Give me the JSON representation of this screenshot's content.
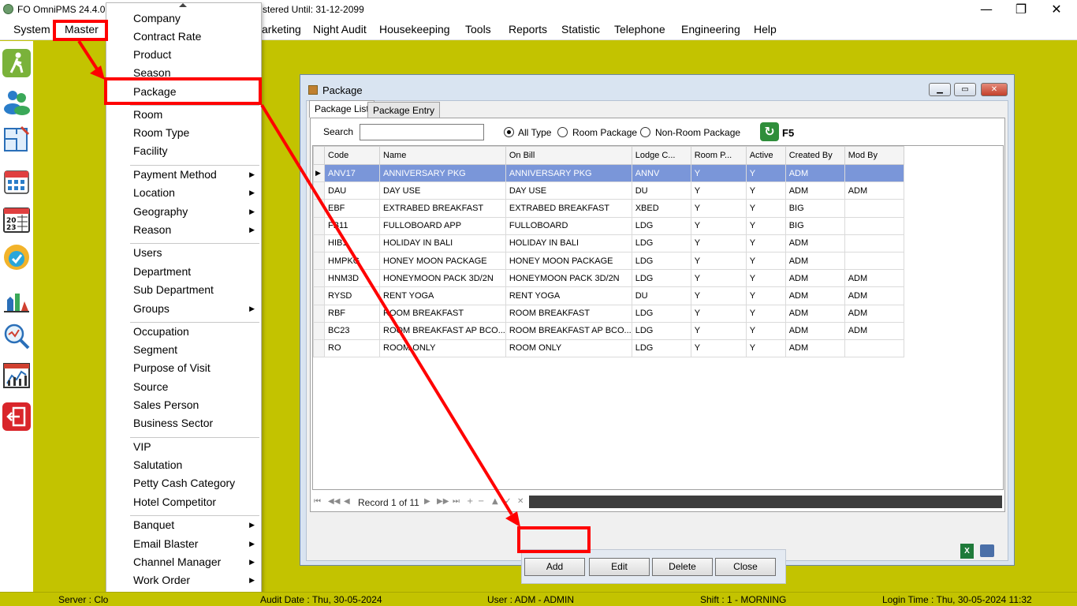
{
  "titlebar": {
    "title": "FO OmniPMS 24.4.0.",
    "title_tail": "stered Until: 31-12-2099",
    "minimize": "—",
    "maximize": "❐",
    "close": "✕"
  },
  "menubar": {
    "items": [
      "System",
      "Master",
      "arketing",
      "Night Audit",
      "Housekeeping",
      "Tools",
      "Reports",
      "Statistic",
      "Telephone",
      "Engineering",
      "Help"
    ]
  },
  "left_toolbar": {
    "icons": [
      "walk-in-icon",
      "guests-icon",
      "floor-plan-icon",
      "calendar-icon",
      "calendar-2023-icon",
      "check-badge-icon",
      "housekeeping-icon",
      "search-chart-icon",
      "statistics-icon",
      "exit-icon"
    ]
  },
  "dropdown": {
    "items": [
      {
        "label": "Company",
        "sub": false
      },
      {
        "label": "Contract Rate",
        "sub": false
      },
      {
        "label": "Product",
        "sub": false
      },
      {
        "label": "Season",
        "sub": false
      },
      {
        "label": "Package",
        "sub": false
      },
      {
        "label": "Room",
        "sub": false
      },
      {
        "label": "Room Type",
        "sub": false
      },
      {
        "label": "Facility",
        "sub": false
      },
      {
        "label": "Payment Method",
        "sub": true
      },
      {
        "label": "Location",
        "sub": true
      },
      {
        "label": "Geography",
        "sub": true
      },
      {
        "label": "Reason",
        "sub": true
      },
      {
        "label": "Users",
        "sub": false
      },
      {
        "label": "Department",
        "sub": false
      },
      {
        "label": "Sub Department",
        "sub": false
      },
      {
        "label": "Groups",
        "sub": true
      },
      {
        "label": "Occupation",
        "sub": false
      },
      {
        "label": "Segment",
        "sub": false
      },
      {
        "label": "Purpose of Visit",
        "sub": false
      },
      {
        "label": "Source",
        "sub": false
      },
      {
        "label": "Sales Person",
        "sub": false
      },
      {
        "label": "Business Sector",
        "sub": false
      },
      {
        "label": "VIP",
        "sub": false
      },
      {
        "label": "Salutation",
        "sub": false
      },
      {
        "label": "Petty Cash Category",
        "sub": false
      },
      {
        "label": "Hotel Competitor",
        "sub": false
      },
      {
        "label": "Banquet",
        "sub": true
      },
      {
        "label": "Email Blaster",
        "sub": true
      },
      {
        "label": "Channel Manager",
        "sub": true
      },
      {
        "label": "Work Order",
        "sub": true
      }
    ],
    "submenu_arrow": "▶"
  },
  "package_window": {
    "title": "Package",
    "tabs": [
      "Package List",
      "Package Entry"
    ],
    "search_label": "Search",
    "search_value": "",
    "filter_options": [
      "All Type",
      "Room Package",
      "Non-Room Package"
    ],
    "filter_selected": "All Type",
    "refresh_label": "F5",
    "columns": [
      "Code",
      "Name",
      "On Bill",
      "Lodge C...",
      "Room P...",
      "Active",
      "Created By",
      "Mod By"
    ],
    "rows": [
      [
        "ANV17",
        "ANNIVERSARY PKG",
        "ANNIVERSARY PKG",
        "ANNV",
        "Y",
        "Y",
        "ADM",
        ""
      ],
      [
        "DAU",
        "DAY USE",
        "DAY USE",
        "DU",
        "Y",
        "Y",
        "ADM",
        "ADM"
      ],
      [
        "EBF",
        "EXTRABED BREAKFAST",
        "EXTRABED BREAKFAST",
        "XBED",
        "Y",
        "Y",
        "BIG",
        ""
      ],
      [
        "FB11",
        "FULLOBOARD APP",
        "FULLOBOARD",
        "LDG",
        "Y",
        "Y",
        "BIG",
        ""
      ],
      [
        "HIB1",
        "HOLIDAY IN BALI",
        "HOLIDAY IN BALI",
        "LDG",
        "Y",
        "Y",
        "ADM",
        ""
      ],
      [
        "HMPKG",
        "HONEY MOON PACKAGE",
        "HONEY MOON PACKAGE",
        "LDG",
        "Y",
        "Y",
        "ADM",
        ""
      ],
      [
        "HNM3D",
        "HONEYMOON PACK 3D/2N",
        "HONEYMOON PACK 3D/2N",
        "LDG",
        "Y",
        "Y",
        "ADM",
        "ADM"
      ],
      [
        "RYSD",
        "RENT YOGA",
        "RENT YOGA",
        "DU",
        "Y",
        "Y",
        "ADM",
        "ADM"
      ],
      [
        "RBF",
        "ROOM BREAKFAST",
        "ROOM BREAKFAST",
        "LDG",
        "Y",
        "Y",
        "ADM",
        "ADM"
      ],
      [
        "BC23",
        "ROOM BREAKFAST AP BCO...",
        "ROOM BREAKFAST AP BCO...",
        "LDG",
        "Y",
        "Y",
        "ADM",
        "ADM"
      ],
      [
        "RO",
        "ROOM ONLY",
        "ROOM ONLY",
        "LDG",
        "Y",
        "Y",
        "ADM",
        ""
      ]
    ],
    "selected_row": 0,
    "row_indicator": "▶",
    "record_text": "Record 1 of 11",
    "buttons": {
      "add": "Add",
      "edit": "Edit",
      "delete": "Delete",
      "close": "Close"
    },
    "export_icons": [
      "excel-icon",
      "printer-icon"
    ]
  },
  "statusbar": {
    "server": "Server : Clo",
    "audit_date": "Audit Date : Thu, 30-05-2024",
    "user": "User : ADM - ADMIN",
    "shift": "Shift : 1 - MORNING",
    "login_time": "Login Time : Thu, 30-05-2024 11:32"
  },
  "colors": {
    "background": "#c3c300",
    "annotation": "#ff0000",
    "selected_row": "#7a96d9"
  }
}
